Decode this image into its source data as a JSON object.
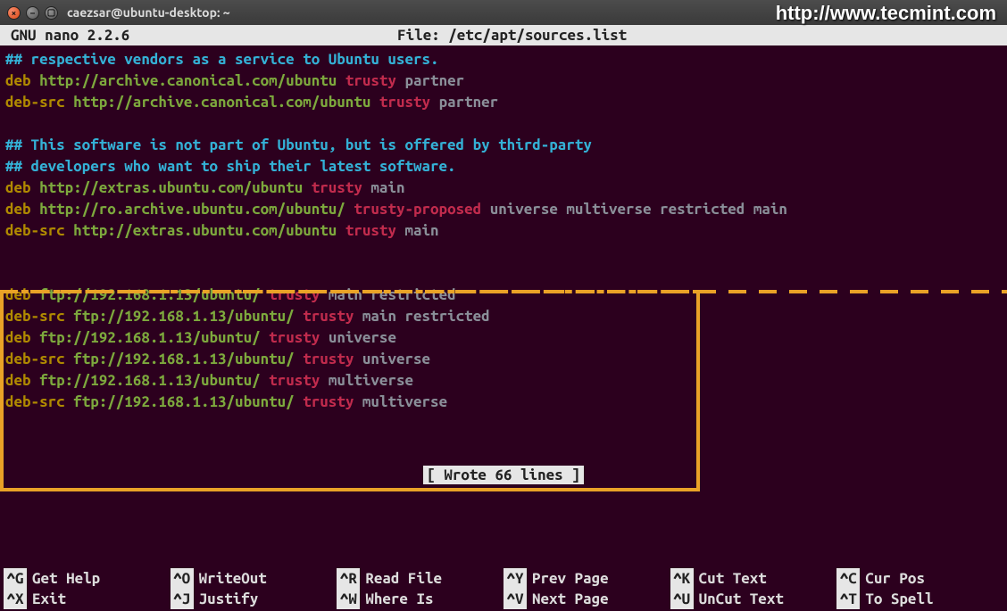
{
  "watermark": "http://www.tecmint.com",
  "window": {
    "title": "caezsar@ubuntu-desktop: ~"
  },
  "nano": {
    "app": "GNU nano 2.2.6",
    "file_prefix": "File: ",
    "file_path": "/etc/apt/sources.list",
    "status": "[ Wrote 66 lines ]"
  },
  "lines": [
    {
      "type": "comment",
      "text": "## respective vendors as a service to Ubuntu users."
    },
    {
      "type": "entry",
      "deb": "deb",
      "url": "http://archive.canonical.com/ubuntu",
      "dist": "trusty",
      "comp": "partner"
    },
    {
      "type": "entry",
      "deb": "deb-src",
      "url": "http://archive.canonical.com/ubuntu",
      "dist": "trusty",
      "comp": "partner"
    },
    {
      "type": "blank"
    },
    {
      "type": "comment",
      "text": "## This software is not part of Ubuntu, but is offered by third-party"
    },
    {
      "type": "comment",
      "text": "## developers who want to ship their latest software."
    },
    {
      "type": "entry",
      "deb": "deb",
      "url": "http://extras.ubuntu.com/ubuntu",
      "dist": "trusty",
      "comp": "main"
    },
    {
      "type": "entry",
      "deb": "deb",
      "url": "http://ro.archive.ubuntu.com/ubuntu/",
      "dist": "trusty-proposed",
      "comp": "universe multiverse restricted main"
    },
    {
      "type": "entry",
      "deb": "deb-src",
      "url": "http://extras.ubuntu.com/ubuntu",
      "dist": "trusty",
      "comp": "main"
    },
    {
      "type": "blank"
    },
    {
      "type": "blank"
    },
    {
      "type": "entry",
      "deb": "deb",
      "url": "ftp://192.168.1.13/ubuntu/",
      "dist": "trusty",
      "comp": "main restricted"
    },
    {
      "type": "entry",
      "deb": "deb-src",
      "url": "ftp://192.168.1.13/ubuntu/",
      "dist": "trusty",
      "comp": "main restricted"
    },
    {
      "type": "entry",
      "deb": "deb",
      "url": "ftp://192.168.1.13/ubuntu/",
      "dist": "trusty",
      "comp": "universe"
    },
    {
      "type": "entry",
      "deb": "deb-src",
      "url": "ftp://192.168.1.13/ubuntu/",
      "dist": "trusty",
      "comp": "universe"
    },
    {
      "type": "entry",
      "deb": "deb",
      "url": "ftp://192.168.1.13/ubuntu/",
      "dist": "trusty",
      "comp": "multiverse"
    },
    {
      "type": "entry",
      "deb": "deb-src",
      "url": "ftp://192.168.1.13/ubuntu/",
      "dist": "trusty",
      "comp": "multiverse"
    }
  ],
  "shortcuts": [
    {
      "key": "^G",
      "label": "Get Help"
    },
    {
      "key": "^O",
      "label": "WriteOut"
    },
    {
      "key": "^R",
      "label": "Read File"
    },
    {
      "key": "^Y",
      "label": "Prev Page"
    },
    {
      "key": "^K",
      "label": "Cut Text"
    },
    {
      "key": "^C",
      "label": "Cur Pos"
    },
    {
      "key": "^X",
      "label": "Exit"
    },
    {
      "key": "^J",
      "label": "Justify"
    },
    {
      "key": "^W",
      "label": "Where Is"
    },
    {
      "key": "^V",
      "label": "Next Page"
    },
    {
      "key": "^U",
      "label": "UnCut Text"
    },
    {
      "key": "^T",
      "label": "To Spell"
    }
  ]
}
